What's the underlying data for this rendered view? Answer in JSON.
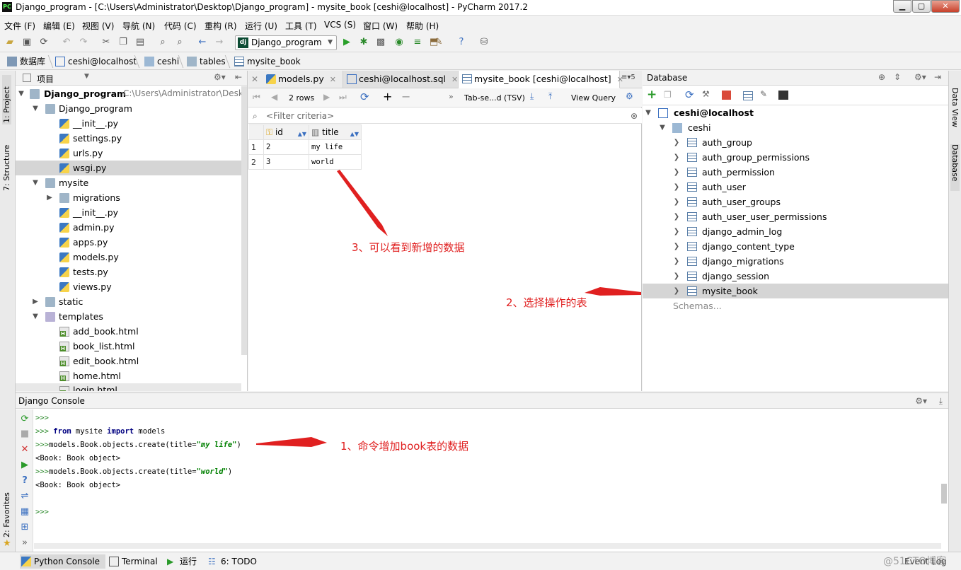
{
  "window": {
    "title": "Django_program - [C:\\Users\\Administrator\\Desktop\\Django_program] - mysite_book [ceshi@localhost] - PyCharm 2017.2",
    "app_icon": "PC"
  },
  "menu": [
    "文件 (F)",
    "编辑 (E)",
    "视图 (V)",
    "导航 (N)",
    "代码 (C)",
    "重构 (R)",
    "运行 (U)",
    "工具 (T)",
    "VCS (S)",
    "窗口 (W)",
    "帮助 (H)"
  ],
  "toolbar": {
    "run_config": "Django_program",
    "run_config_icon": "dj"
  },
  "breadcrumbs": [
    "数据库",
    "ceshi@localhost",
    "ceshi",
    "tables",
    "mysite_book"
  ],
  "left_strip": {
    "project": "1: Project",
    "structure": "7: Structure",
    "favorites": "2: Favorites"
  },
  "right_strip": {
    "sciview": "Data View",
    "database": "Database"
  },
  "project": {
    "header": "项目",
    "root_name": "Django_program",
    "root_path": "C:\\Users\\Administrator\\Desktop",
    "items": [
      {
        "label": "Django_program"
      },
      {
        "label": "__init__.py"
      },
      {
        "label": "settings.py"
      },
      {
        "label": "urls.py"
      },
      {
        "label": "wsgi.py"
      },
      {
        "label": "mysite"
      },
      {
        "label": "migrations"
      },
      {
        "label": "__init__.py"
      },
      {
        "label": "admin.py"
      },
      {
        "label": "apps.py"
      },
      {
        "label": "models.py"
      },
      {
        "label": "tests.py"
      },
      {
        "label": "views.py"
      },
      {
        "label": "static"
      },
      {
        "label": "templates"
      },
      {
        "label": "add_book.html"
      },
      {
        "label": "book_list.html"
      },
      {
        "label": "edit_book.html"
      },
      {
        "label": "home.html"
      },
      {
        "label": "login.html"
      }
    ]
  },
  "editor": {
    "tabs": [
      "models.py",
      "ceshi@localhost.sql",
      "mysite_book [ceshi@localhost]"
    ],
    "tab_overflow": "5",
    "rows_label": "2 rows",
    "format_label": "Tab-se...d (TSV)",
    "view_query": "View Query",
    "filter_placeholder": "<Filter criteria>",
    "columns": [
      "id",
      "title"
    ],
    "rows": [
      {
        "num": "1",
        "id": "2",
        "title": "my life"
      },
      {
        "num": "2",
        "id": "3",
        "title": "world"
      }
    ]
  },
  "database": {
    "header": "Database",
    "connection": "ceshi@localhost",
    "schema": "ceshi",
    "tables": [
      "auth_group",
      "auth_group_permissions",
      "auth_permission",
      "auth_user",
      "auth_user_groups",
      "auth_user_user_permissions",
      "django_admin_log",
      "django_content_type",
      "django_migrations",
      "django_session",
      "mysite_book"
    ],
    "schemas_label": "Schemas..."
  },
  "console": {
    "header": "Django Console",
    "lines": {
      "p1": ">>>",
      "p2": ">>>",
      "l2_kw1": "from",
      "l2_mid": " mysite ",
      "l2_kw2": "import",
      "l2_end": " models",
      "p3": ">>>",
      "l3_a": "models.Book.objects.create(title=",
      "l3_s": "\"my life\"",
      "l3_b": ")",
      "l4": "<Book: Book object>",
      "p5": ">>>",
      "l5_a": "models.Book.objects.create(title=",
      "l5_s": "\"world\"",
      "l5_b": ")",
      "l6": "<Book: Book object>",
      "p7": ">>>"
    }
  },
  "statusbar": {
    "tabs": [
      "Python Console",
      "Terminal",
      "运行",
      "6: TODO"
    ],
    "event_log": "Event Log",
    "watermark": "@51CTO博客"
  },
  "annotations": {
    "a1": "1、命令增加book表的数据",
    "a2": "2、选择操作的表",
    "a3": "3、可以看到新增的数据"
  },
  "colors": {
    "accent_red": "#e02020",
    "selection": "#d5d5d5",
    "keyword": "#000080",
    "string": "#008000"
  }
}
